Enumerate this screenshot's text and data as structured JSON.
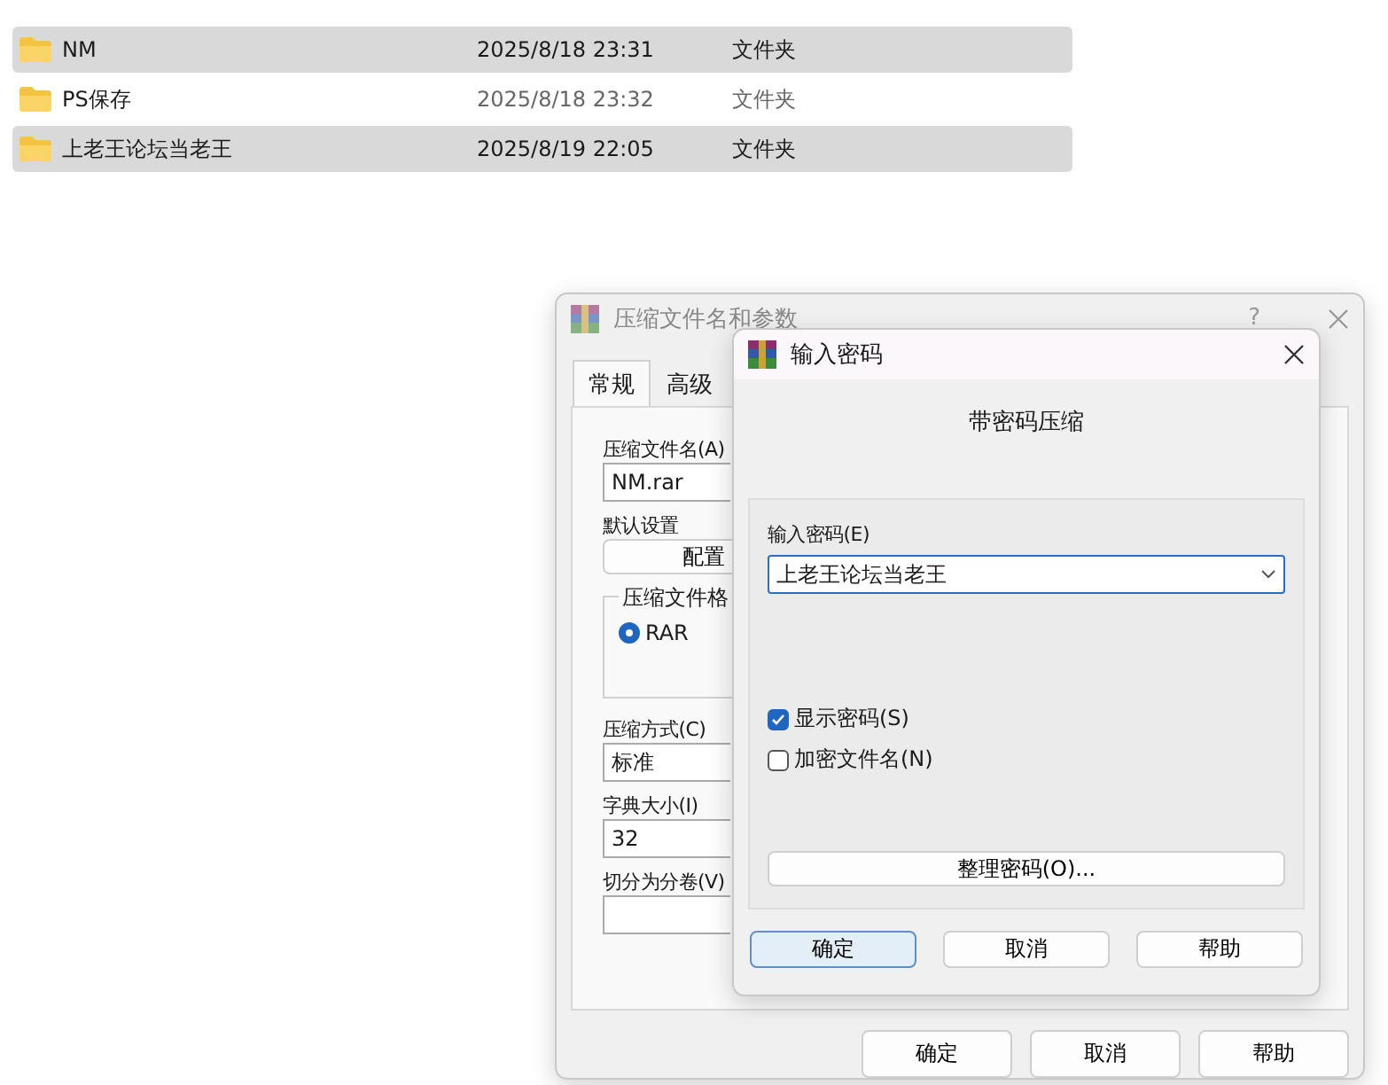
{
  "files": [
    {
      "name": "NM",
      "date": "2025/8/18 23:31",
      "type": "文件夹",
      "selected": true
    },
    {
      "name": "PS保存",
      "date": "2025/8/18 23:32",
      "type": "文件夹",
      "selected": false
    },
    {
      "name": "上老王论坛当老王",
      "date": "2025/8/19 22:05",
      "type": "文件夹",
      "selected": true
    }
  ],
  "archive_dialog": {
    "title": "压缩文件名和参数",
    "help": "?",
    "tabs": [
      {
        "label": "常规",
        "selected": true
      },
      {
        "label": "高级",
        "selected": false
      }
    ],
    "archive_name_label": "压缩文件名(A)",
    "archive_name": "NM.rar",
    "profile_label": "默认设置",
    "profile_button": "配置",
    "format_group": "压缩文件格",
    "format_option": {
      "label": "RAR",
      "selected": true
    },
    "method_label": "压缩方式(C)",
    "method": "标准",
    "dict_label": "字典大小(I)",
    "dict": "32",
    "split_label": "切分为分卷(V)",
    "buttons": [
      "确定",
      "取消",
      "帮助"
    ]
  },
  "password_dialog": {
    "title": "输入密码",
    "heading": "带密码压缩",
    "password_label": "输入密码(E)",
    "password": "上老王论坛当老王",
    "options": [
      {
        "label": "显示密码(S)",
        "checked": true
      },
      {
        "label": "加密文件名(N)",
        "checked": false
      }
    ],
    "organize_button": "整理密码(O)...",
    "buttons": [
      {
        "label": "确定",
        "default": true
      },
      {
        "label": "取消",
        "default": false
      },
      {
        "label": "帮助",
        "default": false
      }
    ]
  }
}
